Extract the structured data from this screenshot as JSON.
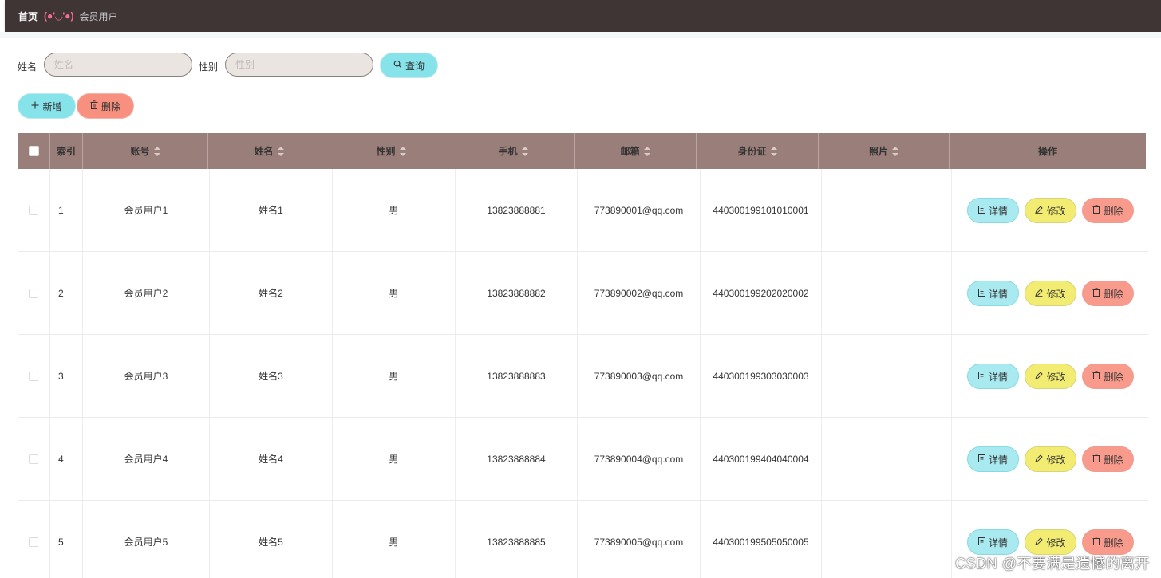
{
  "breadcrumb": {
    "home": "首页",
    "separator": "(●'◡'●)",
    "current": "会员用户"
  },
  "search": {
    "name_label": "姓名",
    "name_placeholder": "姓名",
    "name_value": "",
    "gender_label": "性别",
    "gender_placeholder": "性别",
    "gender_value": "",
    "query_label": "查询"
  },
  "actions": {
    "add_label": "新增",
    "delete_label": "删除"
  },
  "table": {
    "columns": [
      "索引",
      "账号",
      "姓名",
      "性别",
      "手机",
      "邮箱",
      "身份证",
      "照片",
      "操作"
    ],
    "rows": [
      {
        "index": "1",
        "account": "会员用户1",
        "name": "姓名1",
        "gender": "男",
        "phone": "13823888881",
        "email": "773890001@qq.com",
        "id_card": "440300199101010001",
        "photo": ""
      },
      {
        "index": "2",
        "account": "会员用户2",
        "name": "姓名2",
        "gender": "男",
        "phone": "13823888882",
        "email": "773890002@qq.com",
        "id_card": "440300199202020002",
        "photo": ""
      },
      {
        "index": "3",
        "account": "会员用户3",
        "name": "姓名3",
        "gender": "男",
        "phone": "13823888883",
        "email": "773890003@qq.com",
        "id_card": "440300199303030003",
        "photo": ""
      },
      {
        "index": "4",
        "account": "会员用户4",
        "name": "姓名4",
        "gender": "男",
        "phone": "13823888884",
        "email": "773890004@qq.com",
        "id_card": "440300199404040004",
        "photo": ""
      },
      {
        "index": "5",
        "account": "会员用户5",
        "name": "姓名5",
        "gender": "男",
        "phone": "13823888885",
        "email": "773890005@qq.com",
        "id_card": "440300199505050005",
        "photo": ""
      }
    ],
    "row_actions": {
      "detail": "详情",
      "edit": "修改",
      "delete": "删除"
    }
  },
  "icons": {
    "search": "search-icon",
    "add": "plus-icon",
    "delete": "trash-icon",
    "detail": "document-icon",
    "edit": "pencil-icon"
  },
  "colors": {
    "topbar": "#3f3535",
    "header": "#9a7e79",
    "cyan": "#86e3ea",
    "yellow": "#f0e96e",
    "red": "#f7907f"
  },
  "watermark": "CSDN @不要满是遗憾的离开"
}
